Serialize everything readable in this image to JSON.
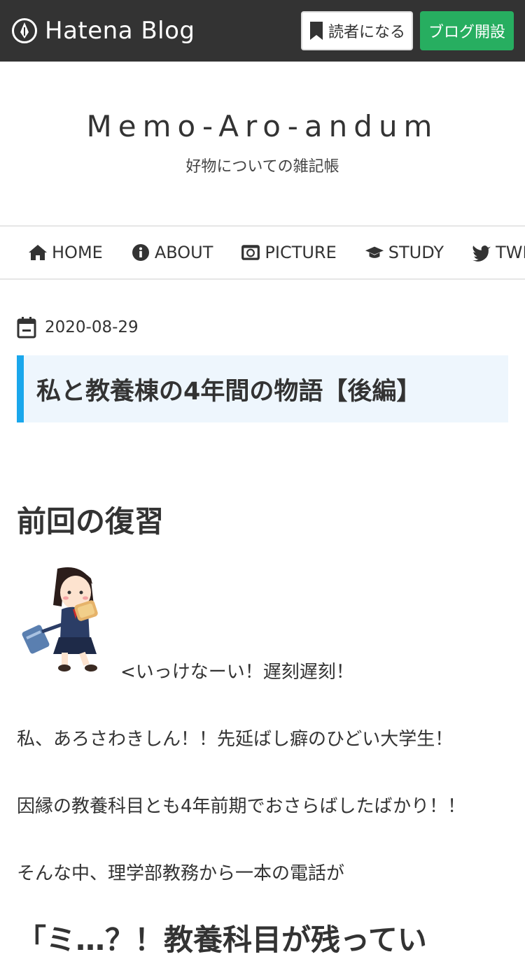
{
  "topbar": {
    "logo_text": "Hatena Blog",
    "reader_button": "読者になる",
    "open_blog_button": "ブログ開設",
    "accent_color": "#27ae60"
  },
  "blog": {
    "title": "Memo-Aro-andum",
    "description": "好物についての雑記帳"
  },
  "nav": {
    "items": [
      {
        "icon": "home-icon",
        "label": "HOME"
      },
      {
        "icon": "info-icon",
        "label": "ABOUT"
      },
      {
        "icon": "camera-icon",
        "label": "PICTURE"
      },
      {
        "icon": "graduation-cap-icon",
        "label": "STUDY"
      },
      {
        "icon": "twitter-icon",
        "label": "TWIT"
      }
    ]
  },
  "entry": {
    "date": "2020-08-29",
    "title": "私と教養棟の4年間の物語【後編】",
    "title_accent": "#1aa7ec"
  },
  "content": {
    "heading1": "前回の復習",
    "speech": "<いっけなーい！遅刻遅刻！",
    "para1": "私、あろさわきしん！！先延ばし癖のひどい大学生！",
    "para2": "因縁の教養科目とも4年前期でおさらばしたばかり！！",
    "para3": "そんな中、理学部教務から一本の電話が",
    "heading2_partial": "「ミ…？！教養科目が残ってい"
  }
}
